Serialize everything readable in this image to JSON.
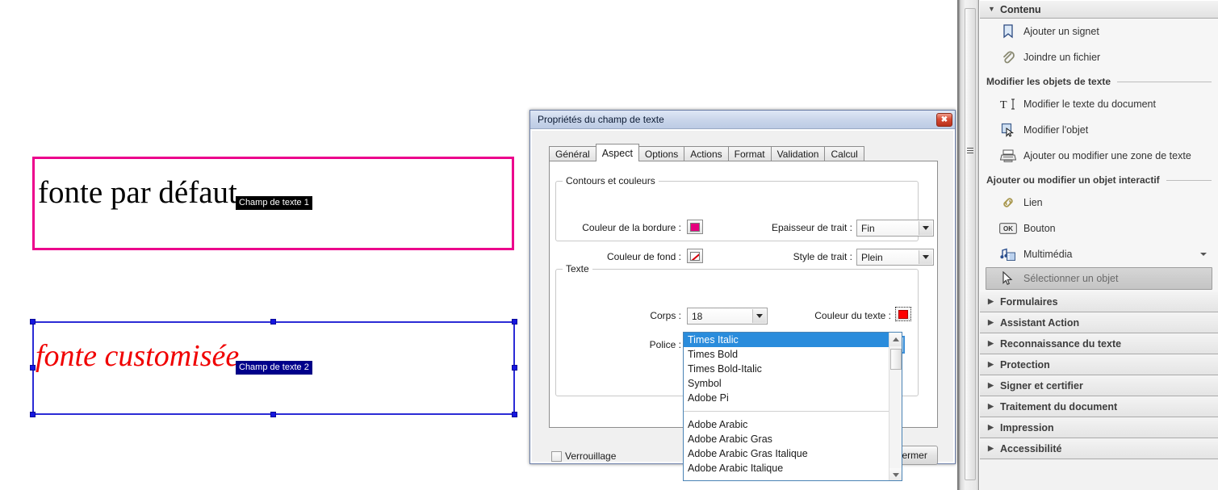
{
  "document": {
    "fields": [
      {
        "name": "Champ de texte 1",
        "text": "fonte par défaut",
        "tooltip": "Champ de texte 1",
        "border_color": "#ec008c",
        "text_color": "#000000"
      },
      {
        "name": "Champ de texte 2",
        "text": "fonte customisée",
        "tooltip": "Champ de texte 2",
        "border_color": "#2b2bd6",
        "text_color": "#f00000"
      }
    ]
  },
  "dialog": {
    "title": "Propriétés du champ de texte",
    "close_label": "✖",
    "tabs": [
      {
        "label": "Général",
        "active": false
      },
      {
        "label": "Aspect",
        "active": true
      },
      {
        "label": "Options",
        "active": false
      },
      {
        "label": "Actions",
        "active": false
      },
      {
        "label": "Format",
        "active": false
      },
      {
        "label": "Validation",
        "active": false
      },
      {
        "label": "Calcul",
        "active": false
      }
    ],
    "groups": {
      "contours": {
        "legend": "Contours et couleurs",
        "border_color_label": "Couleur de la bordure :",
        "border_color_value": "#e6007e",
        "fill_color_label": "Couleur de fond :",
        "fill_color_value": "none",
        "stroke_width_label": "Epaisseur de trait :",
        "stroke_width_value": "Fin",
        "stroke_style_label": "Style de trait :",
        "stroke_style_value": "Plein"
      },
      "texte": {
        "legend": "Texte",
        "size_label": "Corps :",
        "size_value": "18",
        "text_color_label": "Couleur du texte :",
        "text_color_value": "#ff0000",
        "font_label": "Police :",
        "font_value": "Times Italic"
      }
    },
    "font_dropdown": {
      "items": [
        {
          "label": "Times Italic",
          "selected": true
        },
        {
          "label": "Times Bold",
          "selected": false
        },
        {
          "label": "Times Bold-Italic",
          "selected": false
        },
        {
          "label": "Symbol",
          "selected": false
        },
        {
          "label": "Adobe Pi",
          "selected": false
        },
        {
          "separator": true
        },
        {
          "label": "Adobe Arabic",
          "selected": false
        },
        {
          "label": "Adobe Arabic Gras",
          "selected": false
        },
        {
          "label": "Adobe Arabic Gras Italique",
          "selected": false
        },
        {
          "label": "Adobe Arabic Italique",
          "selected": false
        }
      ]
    },
    "footer": {
      "lock_label": "Verrouillage",
      "lock_checked": false,
      "close_button_label": "Fermer"
    }
  },
  "tools_panel": {
    "header": {
      "label": "Contenu",
      "triangle": "▼"
    },
    "tools": [
      {
        "label": "Ajouter un signet",
        "icon": "bookmark-icon"
      },
      {
        "label": "Joindre un fichier",
        "icon": "paperclip-icon"
      }
    ],
    "group_text": {
      "label": "Modifier les objets de texte",
      "items": [
        {
          "label": "Modifier le texte du document",
          "icon": "text-cursor-icon"
        },
        {
          "label": "Modifier l'objet",
          "icon": "edit-object-icon"
        },
        {
          "label": "Ajouter ou modifier une zone de texte",
          "icon": "typewriter-icon"
        }
      ]
    },
    "group_interactive": {
      "label": "Ajouter ou modifier un objet interactif",
      "items": [
        {
          "label": "Lien",
          "icon": "link-icon",
          "caret": false,
          "selected": false
        },
        {
          "label": "Bouton",
          "icon": "ok-button-icon",
          "caret": false,
          "selected": false
        },
        {
          "label": "Multimédia",
          "icon": "multimedia-icon",
          "caret": true,
          "selected": false
        },
        {
          "label": "Sélectionner un objet",
          "icon": "pointer-icon",
          "caret": false,
          "selected": true
        }
      ]
    },
    "sections": [
      {
        "label": "Formulaires",
        "triangle": "▶"
      },
      {
        "label": "Assistant Action",
        "triangle": "▶"
      },
      {
        "label": "Reconnaissance du texte",
        "triangle": "▶"
      },
      {
        "label": "Protection",
        "triangle": "▶"
      },
      {
        "label": "Signer et certifier",
        "triangle": "▶"
      },
      {
        "label": "Traitement du document",
        "triangle": "▶"
      },
      {
        "label": "Impression",
        "triangle": "▶"
      },
      {
        "label": "Accessibilité",
        "triangle": "▶"
      }
    ]
  }
}
